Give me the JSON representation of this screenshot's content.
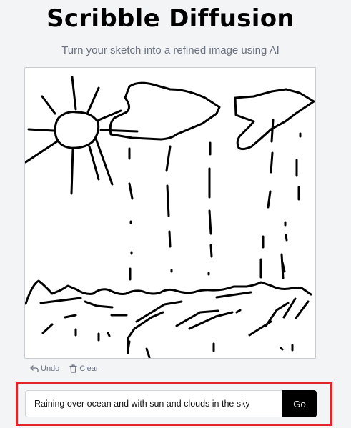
{
  "app": {
    "title": "Scribble Diffusion",
    "subtitle": "Turn your sketch into a refined image using AI"
  },
  "controls": {
    "undo_label": "Undo",
    "undo_icon": "undo-arrow-icon",
    "clear_label": "Clear",
    "clear_icon": "trash-icon"
  },
  "prompt": {
    "value": "Raining over ocean and with sun and clouds in the sky"
  },
  "go_button": {
    "label": "Go"
  },
  "colors": {
    "background": "#f3f4f6",
    "canvas": "#ffffff",
    "ink": "#000000",
    "highlight": "#e3242b",
    "button": "#000000"
  }
}
